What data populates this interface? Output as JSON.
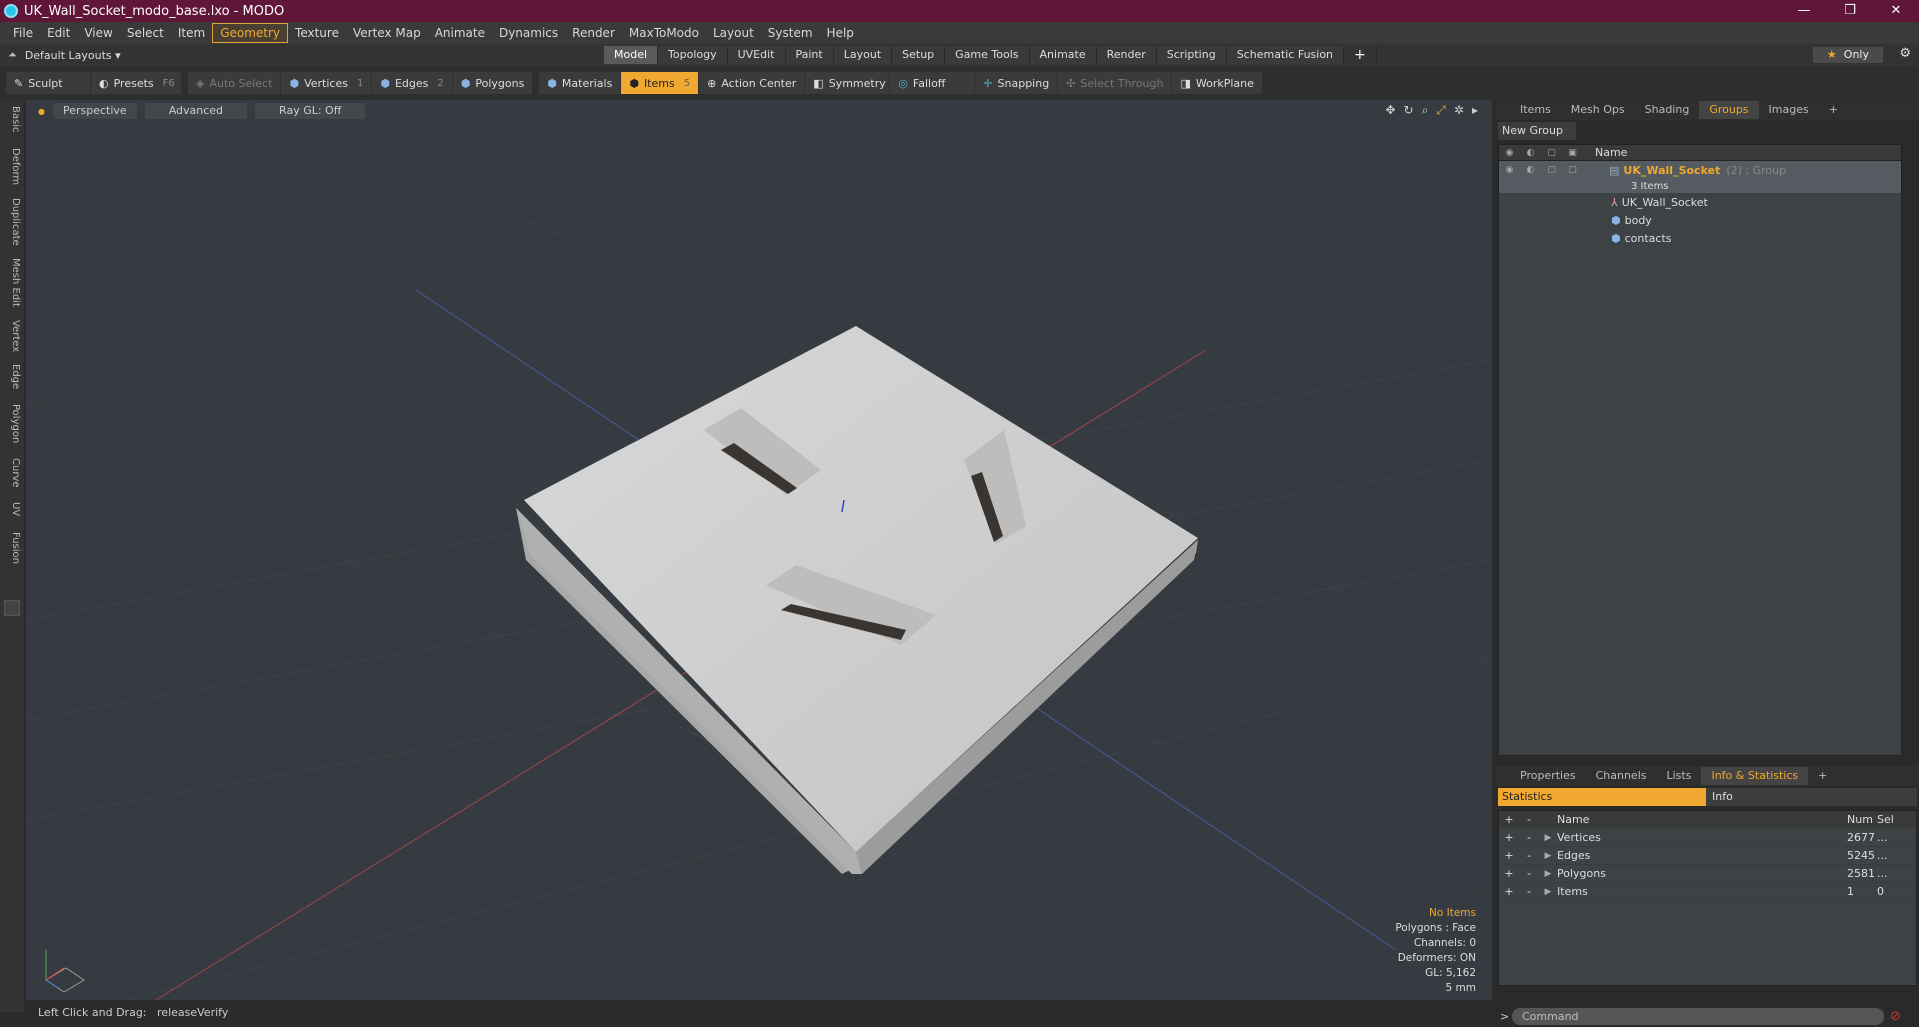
{
  "window": {
    "title": "UK_Wall_Socket_modo_base.lxo - MODO",
    "controls": [
      "—",
      "❐",
      "✕"
    ]
  },
  "menu": [
    "File",
    "Edit",
    "View",
    "Select",
    "Item",
    "Geometry",
    "Texture",
    "Vertex Map",
    "Animate",
    "Dynamics",
    "Render",
    "MaxToModo",
    "Layout",
    "System",
    "Help"
  ],
  "menu_active": "Geometry",
  "layout": {
    "default_layouts": "Default Layouts",
    "tabs": [
      "Model",
      "Topology",
      "UVEdit",
      "Paint",
      "Layout",
      "Setup",
      "Game Tools",
      "Animate",
      "Render",
      "Scripting",
      "Schematic Fusion"
    ],
    "active_tab": "Model",
    "add": "+",
    "only": "Only"
  },
  "toolbar": {
    "sculpt": "Sculpt",
    "presets": "Presets",
    "presets_key": "F6",
    "auto_select": "Auto Select",
    "vertices": "Vertices",
    "vertices_key": "1",
    "edges": "Edges",
    "edges_key": "2",
    "polygons": "Polygons",
    "materials": "Materials",
    "items": "Items",
    "items_key": "5",
    "action_center": "Action Center",
    "symmetry": "Symmetry",
    "falloff": "Falloff",
    "snapping": "Snapping",
    "select_through": "Select Through",
    "workplane": "WorkPlane"
  },
  "left_tabs": [
    "Basic",
    "Deform",
    "Duplicate",
    "Mesh Edit",
    "Vertex",
    "Edge",
    "Polygon",
    "Curve",
    "UV",
    "Fusion"
  ],
  "viewport": {
    "perspective": "Perspective",
    "advanced": "Advanced",
    "raygl": "Ray GL: Off",
    "info": {
      "no_items": "No Items",
      "polygons": "Polygons : Face",
      "channels": "Channels: 0",
      "deformers": "Deformers: ON",
      "gl": "GL: 5,162",
      "scale": "5 mm"
    }
  },
  "status": {
    "hint": "Left Click and Drag:",
    "action": "releaseVerify"
  },
  "groups_panel": {
    "tabs": [
      "Items",
      "Mesh Ops",
      "Shading",
      "Groups",
      "Images"
    ],
    "active": "Groups",
    "add": "+",
    "new_group": "New Group",
    "col_name": "Name",
    "group_name": "UK_Wall_Socket",
    "group_suffix": "(2) : Group",
    "items_count": "3 Items",
    "children": [
      "UK_Wall_Socket",
      "body",
      "contacts"
    ]
  },
  "stats_panel": {
    "tabs": [
      "Properties",
      "Channels",
      "Lists",
      "Info & Statistics"
    ],
    "active": "Info & Statistics",
    "add": "+",
    "statistics": "Statistics",
    "info": "Info",
    "headers": {
      "plus": "+",
      "minus": "-",
      "name": "Name",
      "num": "Num",
      "sel": "Sel"
    },
    "rows": [
      {
        "name": "Vertices",
        "num": "2677",
        "sel": "..."
      },
      {
        "name": "Edges",
        "num": "5245",
        "sel": "..."
      },
      {
        "name": "Polygons",
        "num": "2581",
        "sel": "..."
      },
      {
        "name": "Items",
        "num": "1",
        "sel": "0"
      }
    ]
  },
  "command": {
    "placeholder": "Command",
    "prompt": ">"
  },
  "colors": {
    "accent": "#f0a830",
    "titlebar": "#5f1639",
    "viewport": "#353b40"
  }
}
